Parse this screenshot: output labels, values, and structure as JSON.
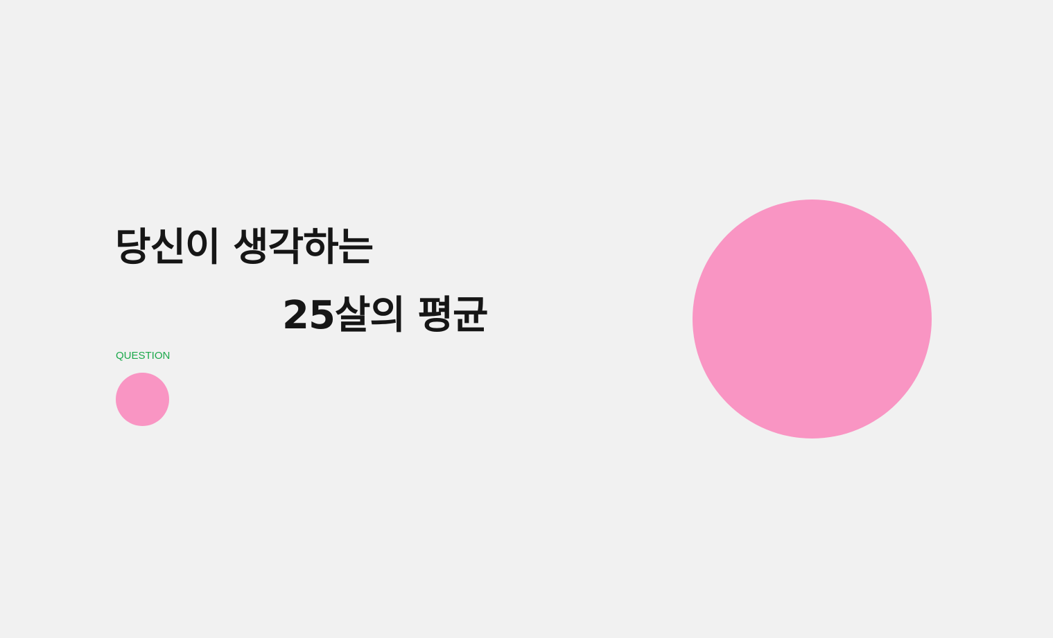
{
  "headline": {
    "line1": "당신이 생각하는",
    "line2": "25살의 평균"
  },
  "question_label": "QUESTION",
  "colors": {
    "background": "#f1f1f1",
    "text": "#161616",
    "accent_green": "#1aa84a",
    "accent_pink": "#f995c3"
  }
}
